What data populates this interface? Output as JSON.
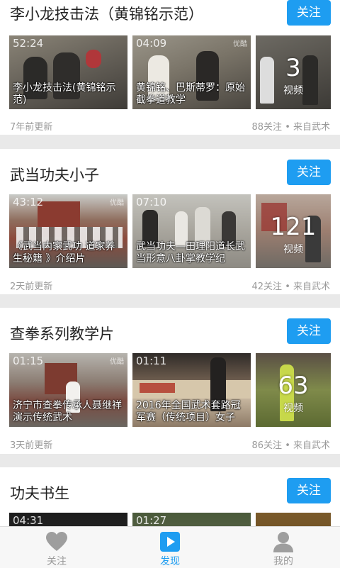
{
  "accent": "#1e9df1",
  "channels": [
    {
      "title": "李小龙技击法（黄锦铭示范）",
      "follow_label": "关注",
      "videos": [
        {
          "duration": "52:24",
          "watermark": "",
          "caption": "李小龙技击法(黄锦铭示范)"
        },
        {
          "duration": "04:09",
          "watermark": "优酷",
          "caption": "黄锦铭、巴斯蒂罗：原始截拳道教学"
        }
      ],
      "video_count": "3",
      "video_count_label": "视频",
      "updated": "7年前更新",
      "stats": "88关注 • 来自武术"
    },
    {
      "title": "武当功夫小子",
      "follow_label": "关注",
      "videos": [
        {
          "duration": "43:12",
          "watermark": "优酷",
          "caption": "《武当内家武功 道家养生秘籍 》介绍片"
        },
        {
          "duration": "07:10",
          "watermark": "",
          "caption": "武当功夫—田理阳道长武当形意八卦掌教学纪"
        }
      ],
      "video_count": "121",
      "video_count_label": "视频",
      "updated": "2天前更新",
      "stats": "42关注 • 来自武术"
    },
    {
      "title": "查拳系列教学片",
      "follow_label": "关注",
      "videos": [
        {
          "duration": "01:15",
          "watermark": "优酷",
          "caption": "济宁市查拳传承人聂继祥演示传统武术"
        },
        {
          "duration": "01:11",
          "watermark": "",
          "caption": "2016年全国武术套路冠军赛（传统项目）女子"
        }
      ],
      "video_count": "63",
      "video_count_label": "视频",
      "updated": "3天前更新",
      "stats": "86关注 • 来自武术"
    },
    {
      "title": "功夫书生",
      "follow_label": "关注",
      "videos": [
        {
          "duration": "04:31",
          "watermark": "",
          "caption": ""
        },
        {
          "duration": "01:27",
          "watermark": "",
          "caption": ""
        }
      ],
      "video_count": "",
      "video_count_label": "",
      "updated": "",
      "stats": ""
    }
  ],
  "tabs": [
    {
      "label": "关注",
      "icon": "heart-icon"
    },
    {
      "label": "发现",
      "icon": "play-icon"
    },
    {
      "label": "我的",
      "icon": "user-icon"
    }
  ]
}
